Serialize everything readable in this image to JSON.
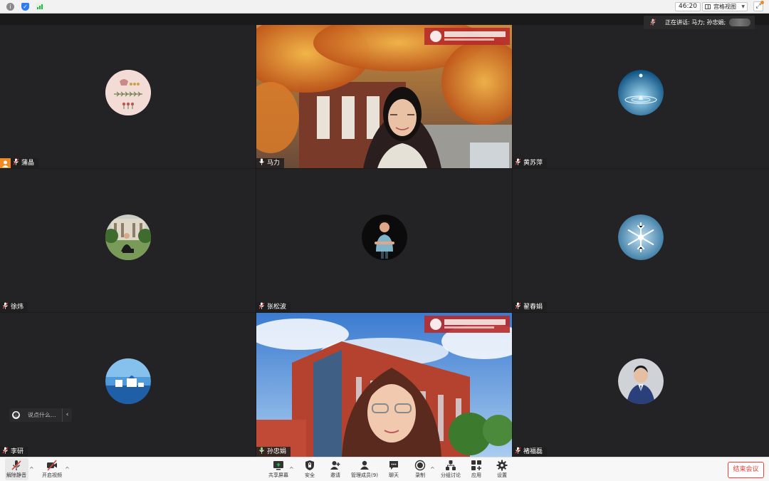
{
  "topbar": {
    "timer": "46:20",
    "view_label": "宫格视图",
    "info_icon": "info-icon",
    "shield_icon": "shield-icon",
    "signal_icon": "signal-icon"
  },
  "speaking": {
    "text": "正在讲话: 马力; 孙忠娟;"
  },
  "participants": [
    {
      "name": "蒲晶"
    },
    {
      "name": "马力"
    },
    {
      "name": "黄苏萍"
    },
    {
      "name": "徐炜"
    },
    {
      "name": "张松波"
    },
    {
      "name": "翟春娟"
    },
    {
      "name": "李研"
    },
    {
      "name": "孙忠娟"
    },
    {
      "name": "褚福磊"
    }
  ],
  "chat": {
    "placeholder": "说点什么..."
  },
  "toolbar": {
    "unmute": "解除静音",
    "start_video": "开启视频",
    "share_screen": "共享屏幕",
    "security": "安全",
    "invite": "邀请",
    "manage_members": "管理成员(9)",
    "chat": "聊天",
    "record": "录制",
    "breakout": "分组讨论",
    "apps": "应用",
    "settings": "设置",
    "end_meeting": "结束会议"
  },
  "colors": {
    "accent_green": "#2ecc40",
    "end_red": "#e0443b",
    "host_orange": "#f08a24"
  }
}
